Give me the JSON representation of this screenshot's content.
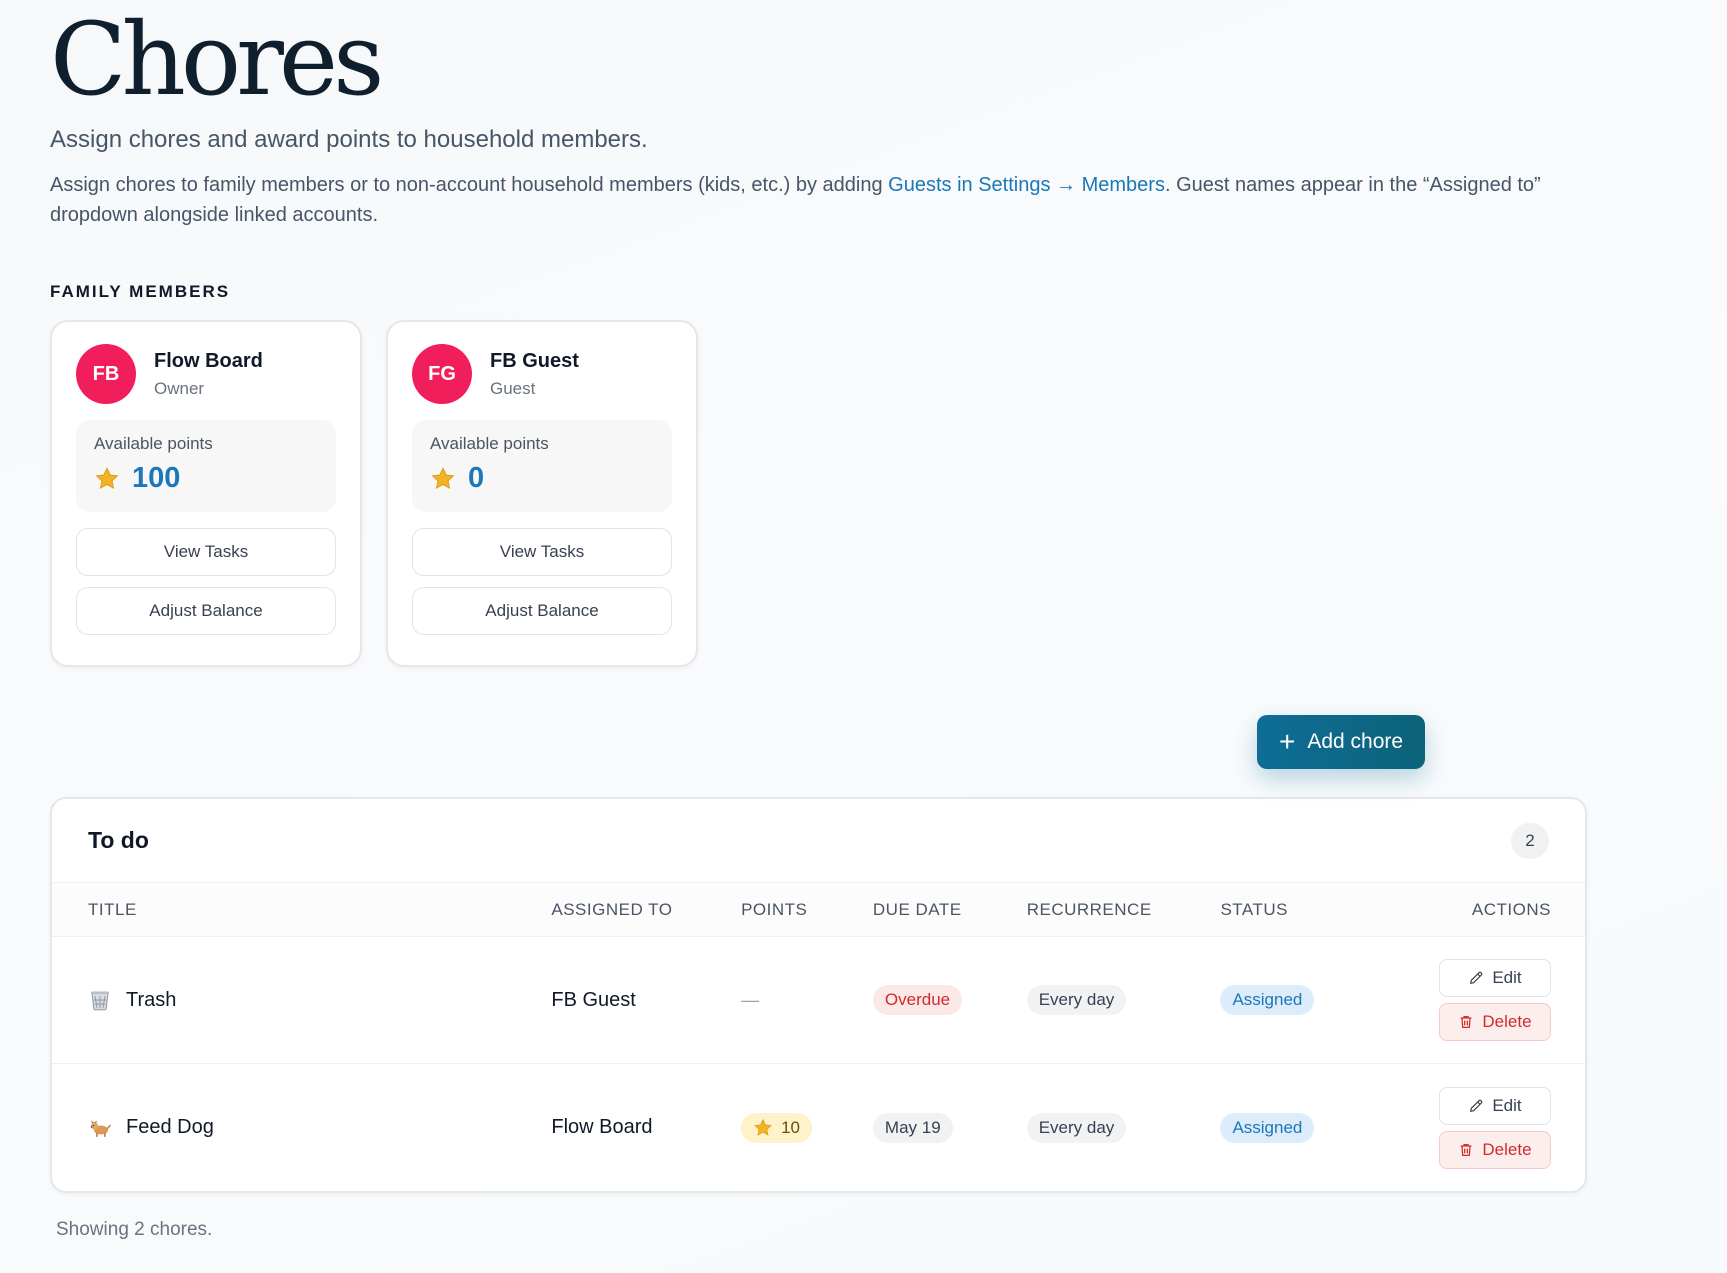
{
  "header": {
    "title": "Chores",
    "subtitle": "Assign chores and award points to household members.",
    "intro_before": "Assign chores to family members or to non-account household members (kids, etc.) by adding ",
    "intro_link": "Guests in Settings → Members",
    "intro_after": ". Guest names appear in the “Assigned to” dropdown alongside linked accounts."
  },
  "family": {
    "section_label": "FAMILY MEMBERS",
    "members": [
      {
        "initials": "FB",
        "name": "Flow Board",
        "role": "Owner",
        "points_label": "Available points",
        "points": "100",
        "view_tasks_label": "View Tasks",
        "adjust_balance_label": "Adjust Balance",
        "avatar_color": "#f21d5b"
      },
      {
        "initials": "FG",
        "name": "FB Guest",
        "role": "Guest",
        "points_label": "Available points",
        "points": "0",
        "view_tasks_label": "View Tasks",
        "adjust_balance_label": "Adjust Balance",
        "avatar_color": "#f21d5b"
      }
    ]
  },
  "toolbar": {
    "add_chore_label": "Add chore",
    "add_icon": "plus-icon"
  },
  "todo": {
    "title": "To do",
    "count": "2",
    "columns": [
      "TITLE",
      "ASSIGNED TO",
      "POINTS",
      "DUE DATE",
      "RECURRENCE",
      "STATUS",
      "ACTIONS"
    ],
    "rows": [
      {
        "icon": "wastebasket-icon",
        "title": "Trash",
        "assigned_to": "FB Guest",
        "points": "—",
        "due": "Overdue",
        "recurrence": "Every day",
        "status": "Assigned",
        "edit_label": "Edit",
        "delete_label": "Delete"
      },
      {
        "icon": "dog-icon",
        "title": "Feed Dog",
        "assigned_to": "Flow Board",
        "points": "10",
        "due": "May 19",
        "recurrence": "Every day",
        "status": "Assigned",
        "edit_label": "Edit",
        "delete_label": "Delete"
      }
    ]
  },
  "footer": {
    "note": "Showing 2 chores."
  },
  "colors": {
    "accent": "#1a78b8",
    "avatar": "#f21d5b",
    "primary_button": "#0f6d96",
    "overdue": "#d02b2b",
    "star": "#f0b429"
  }
}
